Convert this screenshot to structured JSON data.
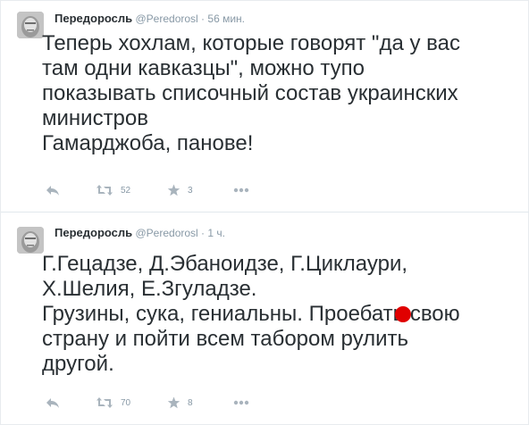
{
  "tweets": [
    {
      "author_name": "Передоросль",
      "handle": "@Peredorosl",
      "separator": "·",
      "time": "56 мин.",
      "text_lines": [
        "Теперь хохлам, которые говорят \"да у вас",
        "там одни кавказцы\", можно тупо",
        "показывать списочный состав украинских",
        "министров",
        "Гамарджоба, панове!"
      ],
      "retweets": "52",
      "favorites": "3"
    },
    {
      "author_name": "Передоросль",
      "handle": "@Peredorosl",
      "separator": "·",
      "time": "1 ч.",
      "text_lines": [
        "Г.Гецадзе, Д.Эбаноидзе, Г.Циклаури,",
        "Х.Шелия, Е.Згуладзе.",
        "Грузины, сука, гениальны. Проебать свою",
        "страну и пойти всем табором рулить",
        "другой."
      ],
      "retweets": "70",
      "favorites": "8"
    }
  ],
  "icons": {
    "reply": "reply-icon",
    "retweet": "retweet-icon",
    "favorite": "star-icon",
    "more": "more-icon",
    "avatar": "avatar"
  },
  "colors": {
    "text": "#292f33",
    "meta": "#8899a6",
    "icon": "#a9b4bd",
    "divider": "#e1e8ed",
    "dot": "#e00000"
  }
}
